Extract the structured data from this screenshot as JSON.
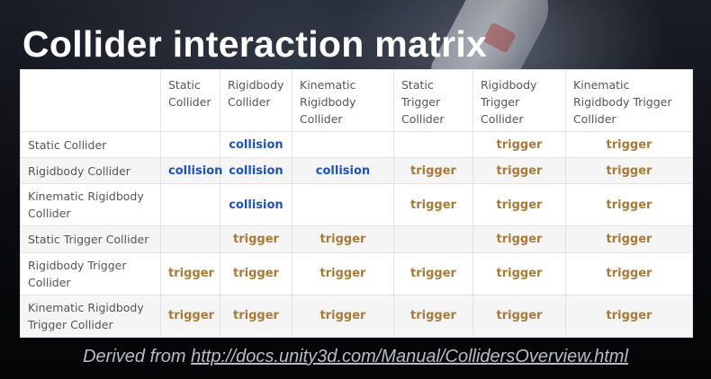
{
  "slide": {
    "title": "Collider interaction matrix",
    "footer_prefix": "Derived from ",
    "footer_link": "http://docs.unity3d.com/Manual/CollidersOverview.html"
  },
  "colors": {
    "collision": "#1f52b8",
    "trigger": "#a87a3a"
  },
  "matrix": {
    "columns": [
      "",
      "Static\nCollider",
      "Rigidbody\nCollider",
      "Kinematic\nRigidbody\nCollider",
      "Static\nTrigger\nCollider",
      "Rigidbody\nTrigger\nCollider",
      "Kinematic\nRigidbody Trigger\nCollider"
    ],
    "rows": [
      {
        "label": "Static Collider",
        "cells": [
          "",
          "collision",
          "",
          "",
          "trigger",
          "trigger"
        ]
      },
      {
        "label": "Rigidbody Collider",
        "cells": [
          "collision",
          "collision",
          "collision",
          "trigger",
          "trigger",
          "trigger"
        ]
      },
      {
        "label": "Kinematic Rigidbody\nCollider",
        "cells": [
          "",
          "collision",
          "",
          "trigger",
          "trigger",
          "trigger"
        ]
      },
      {
        "label": "Static Trigger Collider",
        "cells": [
          "",
          "trigger",
          "trigger",
          "",
          "trigger",
          "trigger"
        ]
      },
      {
        "label": "Rigidbody Trigger\nCollider",
        "cells": [
          "trigger",
          "trigger",
          "trigger",
          "trigger",
          "trigger",
          "trigger"
        ]
      },
      {
        "label": "Kinematic Rigidbody\nTrigger Collider",
        "cells": [
          "trigger",
          "trigger",
          "trigger",
          "trigger",
          "trigger",
          "trigger"
        ]
      }
    ]
  }
}
